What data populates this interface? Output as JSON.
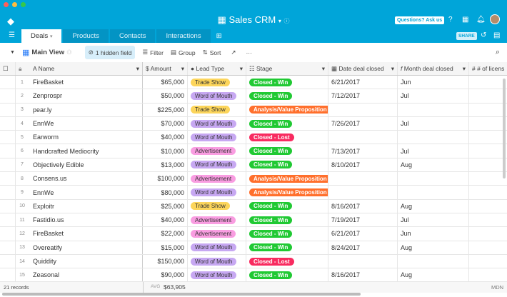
{
  "app": {
    "title": "Sales CRM",
    "ask_label": "Questions? Ask us",
    "share_label": "SHARE"
  },
  "tabs": [
    {
      "label": "Deals"
    },
    {
      "label": "Products"
    },
    {
      "label": "Contacts"
    },
    {
      "label": "Interactions"
    }
  ],
  "toolbar": {
    "view": "Main View",
    "hidden": "1 hidden field",
    "filter": "Filter",
    "group": "Group",
    "sort": "Sort"
  },
  "columns": {
    "name": "Name",
    "amount": "Amount",
    "lead": "Lead Type",
    "stage": "Stage",
    "date": "Date deal closed",
    "month": "Month deal closed",
    "licenses": "# of licens"
  },
  "colors": {
    "Trade Show": "#fcd55b",
    "Word of Mouth": "#c7a8f2",
    "Advertisement": "#f99de1",
    "Closed - Win": "#20c933",
    "Closed - Lost": "#f82b60",
    "Analysis/Value Proposition": "#ff6f2c"
  },
  "rows": [
    {
      "n": "1",
      "name": "FireBasket",
      "amount": "$65,000",
      "lead": "Trade Show",
      "stage": "Closed - Win",
      "date": "6/21/2017",
      "month": "Jun"
    },
    {
      "n": "2",
      "name": "Zenprospr",
      "amount": "$50,000",
      "lead": "Word of Mouth",
      "stage": "Closed - Win",
      "date": "7/12/2017",
      "month": "Jul"
    },
    {
      "n": "3",
      "name": "pear.ly",
      "amount": "$225,000",
      "lead": "Trade Show",
      "stage": "Analysis/Value Proposition",
      "date": "",
      "month": ""
    },
    {
      "n": "4",
      "name": "EnnWe",
      "amount": "$70,000",
      "lead": "Word of Mouth",
      "stage": "Closed - Win",
      "date": "7/26/2017",
      "month": "Jul"
    },
    {
      "n": "5",
      "name": "Earworm",
      "amount": "$40,000",
      "lead": "Word of Mouth",
      "stage": "Closed - Lost",
      "date": "",
      "month": ""
    },
    {
      "n": "6",
      "name": "Handcrafted Mediocrity",
      "amount": "$10,000",
      "lead": "Advertisement",
      "stage": "Closed - Win",
      "date": "7/13/2017",
      "month": "Jul"
    },
    {
      "n": "7",
      "name": "Objectively Edible",
      "amount": "$13,000",
      "lead": "Word of Mouth",
      "stage": "Closed - Win",
      "date": "8/10/2017",
      "month": "Aug"
    },
    {
      "n": "8",
      "name": "Consens.us",
      "amount": "$100,000",
      "lead": "Advertisement",
      "stage": "Analysis/Value Proposition",
      "date": "",
      "month": ""
    },
    {
      "n": "9",
      "name": "EnnWe",
      "amount": "$80,000",
      "lead": "Word of Mouth",
      "stage": "Analysis/Value Proposition",
      "date": "",
      "month": ""
    },
    {
      "n": "10",
      "name": "Exploitr",
      "amount": "$25,000",
      "lead": "Trade Show",
      "stage": "Closed - Win",
      "date": "8/16/2017",
      "month": "Aug"
    },
    {
      "n": "11",
      "name": "Fastidio.us",
      "amount": "$40,000",
      "lead": "Advertisement",
      "stage": "Closed - Win",
      "date": "7/19/2017",
      "month": "Jul"
    },
    {
      "n": "12",
      "name": "FireBasket",
      "amount": "$22,000",
      "lead": "Advertisement",
      "stage": "Closed - Win",
      "date": "6/21/2017",
      "month": "Jun"
    },
    {
      "n": "13",
      "name": "Overeatify",
      "amount": "$15,000",
      "lead": "Word of Mouth",
      "stage": "Closed - Win",
      "date": "8/24/2017",
      "month": "Aug"
    },
    {
      "n": "14",
      "name": "Quiddity",
      "amount": "$150,000",
      "lead": "Word of Mouth",
      "stage": "Closed - Lost",
      "date": "",
      "month": ""
    },
    {
      "n": "15",
      "name": "Zeasonal",
      "amount": "$90,000",
      "lead": "Word of Mouth",
      "stage": "Closed - Win",
      "date": "8/16/2017",
      "month": "Aug"
    }
  ],
  "footer": {
    "records": "21 records",
    "avg_label": "AVG",
    "avg_value": "$63,905",
    "mdn": "MDN"
  }
}
